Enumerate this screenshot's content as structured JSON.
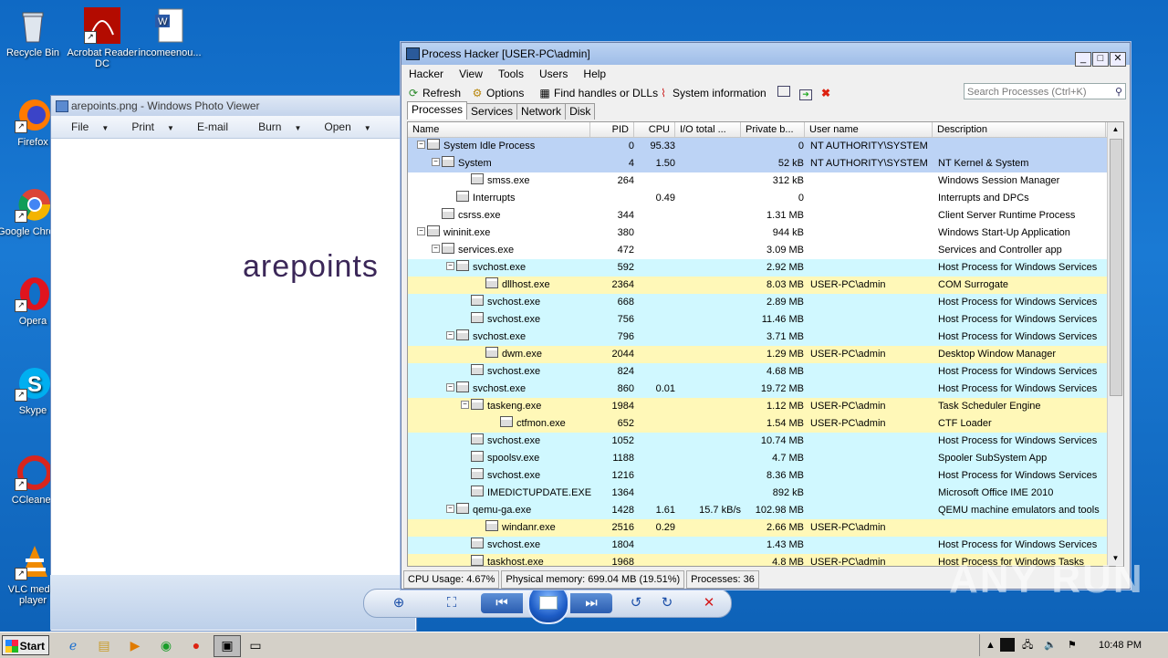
{
  "desktop": {
    "icons": [
      {
        "label": "Recycle Bin",
        "icon": "recycle-bin-icon"
      },
      {
        "label": "Acrobat Reader DC",
        "icon": "acrobat-icon"
      },
      {
        "label": "incomeenou...",
        "icon": "word-doc-icon"
      },
      {
        "label": "Firefox",
        "icon": "firefox-icon"
      },
      {
        "label": "Google Chrome",
        "icon": "chrome-icon"
      },
      {
        "label": "Opera",
        "icon": "opera-icon"
      },
      {
        "label": "Skype",
        "icon": "skype-icon"
      },
      {
        "label": "CCleaner",
        "icon": "ccleaner-icon"
      },
      {
        "label": "VLC media player",
        "icon": "vlc-icon"
      }
    ]
  },
  "photo_viewer": {
    "title": "arepoints.png - Windows Photo Viewer",
    "menu": [
      "File",
      "Print",
      "E-mail",
      "Burn",
      "Open"
    ],
    "image_text": "arepoints"
  },
  "process_hacker": {
    "title": "Process Hacker [USER-PC\\admin]",
    "menu": [
      "Hacker",
      "View",
      "Tools",
      "Users",
      "Help"
    ],
    "toolbar": {
      "refresh": "Refresh",
      "options": "Options",
      "find_handles": "Find handles or DLLs",
      "system_info": "System information",
      "search_placeholder": "Search Processes (Ctrl+K)"
    },
    "tabs": [
      "Processes",
      "Services",
      "Network",
      "Disk"
    ],
    "columns": [
      "Name",
      "PID",
      "CPU",
      "I/O total ...",
      "Private b...",
      "User name",
      "Description"
    ],
    "rows": [
      {
        "name": "System Idle Process",
        "pid": "0",
        "cpu": "95.33",
        "io": "",
        "pb": "0",
        "user": "NT AUTHORITY\\SYSTEM",
        "desc": "",
        "level": 0,
        "exp": "−",
        "bg": "#bcd3f5"
      },
      {
        "name": "System",
        "pid": "4",
        "cpu": "1.50",
        "io": "",
        "pb": "52 kB",
        "user": "NT AUTHORITY\\SYSTEM",
        "desc": "NT Kernel & System",
        "level": 1,
        "exp": "−",
        "bg": "#bcd3f5"
      },
      {
        "name": "smss.exe",
        "pid": "264",
        "cpu": "",
        "io": "",
        "pb": "312 kB",
        "user": "",
        "desc": "Windows Session Manager",
        "level": 3,
        "exp": "",
        "bg": "#ffffff"
      },
      {
        "name": "Interrupts",
        "pid": "",
        "cpu": "0.49",
        "io": "",
        "pb": "0",
        "user": "",
        "desc": "Interrupts and DPCs",
        "level": 2,
        "exp": "",
        "bg": "#ffffff"
      },
      {
        "name": "csrss.exe",
        "pid": "344",
        "cpu": "",
        "io": "",
        "pb": "1.31 MB",
        "user": "",
        "desc": "Client Server Runtime Process",
        "level": 1,
        "exp": "",
        "bg": "#ffffff"
      },
      {
        "name": "wininit.exe",
        "pid": "380",
        "cpu": "",
        "io": "",
        "pb": "944 kB",
        "user": "",
        "desc": "Windows Start-Up Application",
        "level": 0,
        "exp": "−",
        "bg": "#ffffff"
      },
      {
        "name": "services.exe",
        "pid": "472",
        "cpu": "",
        "io": "",
        "pb": "3.09 MB",
        "user": "",
        "desc": "Services and Controller app",
        "level": 1,
        "exp": "−",
        "bg": "#ffffff"
      },
      {
        "name": "svchost.exe",
        "pid": "592",
        "cpu": "",
        "io": "",
        "pb": "2.92 MB",
        "user": "",
        "desc": "Host Process for Windows Services",
        "level": 2,
        "exp": "−",
        "bg": "#d0f8ff"
      },
      {
        "name": "dllhost.exe",
        "pid": "2364",
        "cpu": "",
        "io": "",
        "pb": "8.03 MB",
        "user": "USER-PC\\admin",
        "desc": "COM Surrogate",
        "level": 4,
        "exp": "",
        "bg": "#fff8b8"
      },
      {
        "name": "svchost.exe",
        "pid": "668",
        "cpu": "",
        "io": "",
        "pb": "2.89 MB",
        "user": "",
        "desc": "Host Process for Windows Services",
        "level": 3,
        "exp": "",
        "bg": "#d0f8ff"
      },
      {
        "name": "svchost.exe",
        "pid": "756",
        "cpu": "",
        "io": "",
        "pb": "11.46 MB",
        "user": "",
        "desc": "Host Process for Windows Services",
        "level": 3,
        "exp": "",
        "bg": "#d0f8ff"
      },
      {
        "name": "svchost.exe",
        "pid": "796",
        "cpu": "",
        "io": "",
        "pb": "3.71 MB",
        "user": "",
        "desc": "Host Process for Windows Services",
        "level": 2,
        "exp": "−",
        "bg": "#d0f8ff"
      },
      {
        "name": "dwm.exe",
        "pid": "2044",
        "cpu": "",
        "io": "",
        "pb": "1.29 MB",
        "user": "USER-PC\\admin",
        "desc": "Desktop Window Manager",
        "level": 4,
        "exp": "",
        "bg": "#fff8b8"
      },
      {
        "name": "svchost.exe",
        "pid": "824",
        "cpu": "",
        "io": "",
        "pb": "4.68 MB",
        "user": "",
        "desc": "Host Process for Windows Services",
        "level": 3,
        "exp": "",
        "bg": "#d0f8ff"
      },
      {
        "name": "svchost.exe",
        "pid": "860",
        "cpu": "0.01",
        "io": "",
        "pb": "19.72 MB",
        "user": "",
        "desc": "Host Process for Windows Services",
        "level": 2,
        "exp": "−",
        "bg": "#d0f8ff"
      },
      {
        "name": "taskeng.exe",
        "pid": "1984",
        "cpu": "",
        "io": "",
        "pb": "1.12 MB",
        "user": "USER-PC\\admin",
        "desc": "Task Scheduler Engine",
        "level": 3,
        "exp": "−",
        "bg": "#fff8b8"
      },
      {
        "name": "ctfmon.exe",
        "pid": "652",
        "cpu": "",
        "io": "",
        "pb": "1.54 MB",
        "user": "USER-PC\\admin",
        "desc": "CTF Loader",
        "level": 5,
        "exp": "",
        "bg": "#fff8b8"
      },
      {
        "name": "svchost.exe",
        "pid": "1052",
        "cpu": "",
        "io": "",
        "pb": "10.74 MB",
        "user": "",
        "desc": "Host Process for Windows Services",
        "level": 3,
        "exp": "",
        "bg": "#d0f8ff"
      },
      {
        "name": "spoolsv.exe",
        "pid": "1188",
        "cpu": "",
        "io": "",
        "pb": "4.7 MB",
        "user": "",
        "desc": "Spooler SubSystem App",
        "level": 3,
        "exp": "",
        "bg": "#d0f8ff"
      },
      {
        "name": "svchost.exe",
        "pid": "1216",
        "cpu": "",
        "io": "",
        "pb": "8.36 MB",
        "user": "",
        "desc": "Host Process for Windows Services",
        "level": 3,
        "exp": "",
        "bg": "#d0f8ff"
      },
      {
        "name": "IMEDICTUPDATE.EXE",
        "pid": "1364",
        "cpu": "",
        "io": "",
        "pb": "892 kB",
        "user": "",
        "desc": "Microsoft Office IME 2010",
        "level": 3,
        "exp": "",
        "bg": "#d0f8ff"
      },
      {
        "name": "qemu-ga.exe",
        "pid": "1428",
        "cpu": "1.61",
        "io": "15.7 kB/s",
        "pb": "102.98 MB",
        "user": "",
        "desc": "QEMU machine emulators and tools",
        "level": 2,
        "exp": "−",
        "bg": "#d0f8ff"
      },
      {
        "name": "windanr.exe",
        "pid": "2516",
        "cpu": "0.29",
        "io": "",
        "pb": "2.66 MB",
        "user": "USER-PC\\admin",
        "desc": "",
        "level": 4,
        "exp": "",
        "bg": "#fff8b8"
      },
      {
        "name": "svchost.exe",
        "pid": "1804",
        "cpu": "",
        "io": "",
        "pb": "1.43 MB",
        "user": "",
        "desc": "Host Process for Windows Services",
        "level": 3,
        "exp": "",
        "bg": "#d0f8ff"
      },
      {
        "name": "taskhost.exe",
        "pid": "1968",
        "cpu": "",
        "io": "",
        "pb": "4.8 MB",
        "user": "USER-PC\\admin",
        "desc": "Host Process for Windows Tasks",
        "level": 3,
        "exp": "",
        "bg": "#fff8b8"
      }
    ],
    "status": {
      "cpu": "CPU Usage: 4.67%",
      "memory": "Physical memory: 699.04 MB (19.51%)",
      "processes": "Processes: 36"
    }
  },
  "taskbar": {
    "start": "Start",
    "clock": "10:48 PM"
  },
  "watermark": "ANY RUN"
}
